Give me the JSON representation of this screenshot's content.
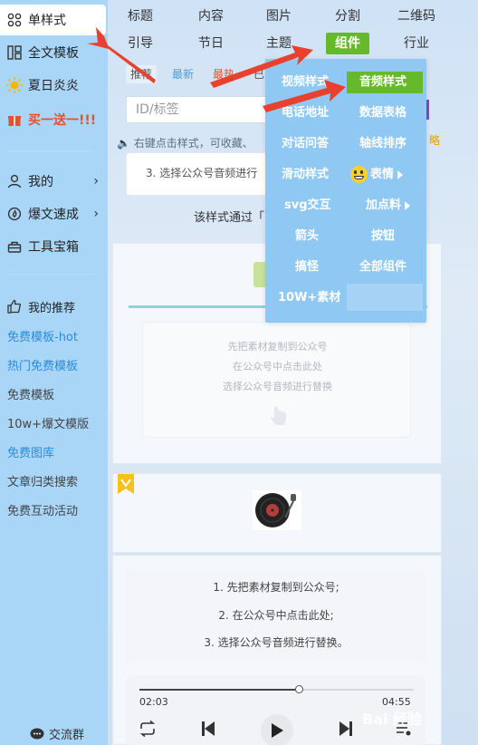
{
  "sidebar": {
    "nav": [
      {
        "label": "单样式",
        "icon": "grid-icon"
      },
      {
        "label": "全文模板",
        "icon": "layout-icon"
      },
      {
        "label": "夏日炎炎",
        "icon": "sun-icon"
      },
      {
        "label": "买一送一!!!",
        "icon": "gift-icon"
      }
    ],
    "menu": [
      {
        "label": "我的",
        "icon": "user-icon"
      },
      {
        "label": "爆文速成",
        "icon": "fire-icon"
      },
      {
        "label": "工具宝箱",
        "icon": "toolbox-icon"
      }
    ],
    "recommend_label": "我的推荐",
    "links": [
      "免费模板-hot",
      "热门免费模板",
      "免费模板",
      "10w+爆文模版",
      "免费图库",
      "文章归类搜索",
      "免费互动活动"
    ],
    "footer": "交流群"
  },
  "categories": {
    "row1": [
      "标题",
      "内容",
      "图片",
      "分割",
      "二维码"
    ],
    "row2": [
      "引导",
      "节日",
      "主题",
      "组件",
      "行业"
    ]
  },
  "subtabs": [
    "推荐",
    "最新",
    "最热",
    "已"
  ],
  "search": {
    "placeholder": "ID/标签"
  },
  "notice": "右键点击样式，可收藏、",
  "notice_right": "略",
  "card1": {
    "text": "3. 选择公众号音频进行"
  },
  "pass_text": "该样式通过「",
  "card2": {
    "lines": [
      "先把素材复制到公众号",
      "在公众号中点击此处",
      "选择公众号音频进行替换"
    ]
  },
  "card3": {
    "lines": [
      "1. 先把素材复制到公众号;",
      "2. 在公众号中点击此处;",
      "3. 选择公众号音频进行替换。"
    ]
  },
  "player": {
    "current": "02:03",
    "total": "04:55",
    "progress": 0.58
  },
  "dropdown": {
    "items": [
      {
        "label": "视频样式",
        "selected": false,
        "arrow": false
      },
      {
        "label": "音频样式",
        "selected": true,
        "arrow": false
      },
      {
        "label": "电话地址",
        "selected": false,
        "arrow": false
      },
      {
        "label": "数据表格",
        "selected": false,
        "arrow": false
      },
      {
        "label": "对话问答",
        "selected": false,
        "arrow": false
      },
      {
        "label": "轴线排序",
        "selected": false,
        "arrow": false
      },
      {
        "label": "滑动样式",
        "selected": false,
        "arrow": false
      },
      {
        "label": "表情",
        "selected": false,
        "arrow": true
      },
      {
        "label": "svg交互",
        "selected": false,
        "arrow": false
      },
      {
        "label": "加点料",
        "selected": false,
        "arrow": true
      },
      {
        "label": "箭头",
        "selected": false,
        "arrow": false
      },
      {
        "label": "按钮",
        "selected": false,
        "arrow": false
      },
      {
        "label": "搞怪",
        "selected": false,
        "arrow": false
      },
      {
        "label": "全部组件",
        "selected": false,
        "arrow": false
      },
      {
        "label": "10W+素材",
        "selected": false,
        "arrow": false
      }
    ]
  },
  "watermark": "Bai 经验",
  "colors": {
    "accent": "#66b92b",
    "sidebar": "#a9d5f7",
    "dropdown": "#8fc8f3",
    "arrow": "#e8412f",
    "link_blue": "#2a8cd8",
    "hot_red": "#e5502e"
  }
}
